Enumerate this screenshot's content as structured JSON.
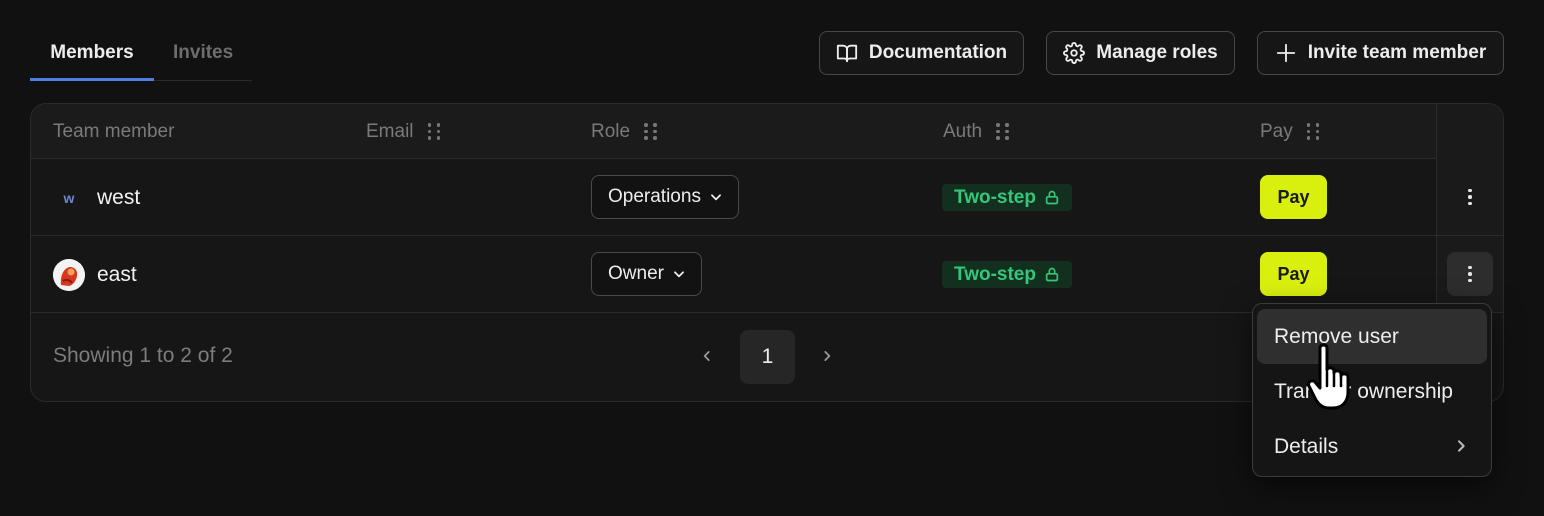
{
  "tabs": [
    {
      "label": "Members",
      "active": true
    },
    {
      "label": "Invites",
      "active": false
    }
  ],
  "toolbar": {
    "documentation_label": "Documentation",
    "manage_roles_label": "Manage roles",
    "invite_label": "Invite team member"
  },
  "table": {
    "columns": [
      "Team member",
      "Email",
      "Role",
      "Auth",
      "Pay"
    ],
    "rows": [
      {
        "avatar": "w",
        "name": "west",
        "role": "Operations",
        "auth": "Two-step",
        "pay": "Pay"
      },
      {
        "avatar": "image",
        "name": "east",
        "role": "Owner",
        "auth": "Two-step",
        "pay": "Pay"
      }
    ]
  },
  "footer": {
    "showing": "Showing 1 to 2 of 2",
    "current_page": "1"
  },
  "context_menu": {
    "items": [
      "Remove user",
      "Transfer ownership",
      "Details"
    ]
  },
  "colors": {
    "accent": "#4f7de3",
    "pay_button": "#d9f00f",
    "auth_badge_text": "#34c77b",
    "auth_badge_bg": "#13301f"
  }
}
